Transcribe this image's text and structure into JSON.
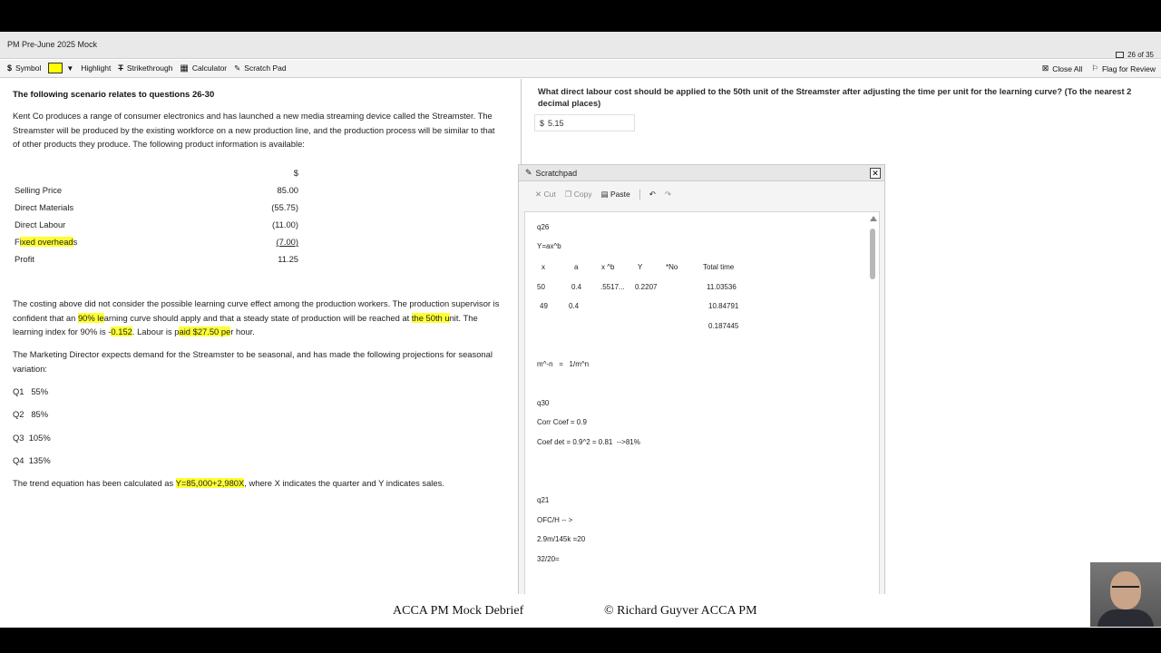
{
  "exam": {
    "title": "PM Pre-June 2025 Mock",
    "counter": "26 of 35"
  },
  "toolbar": {
    "symbol": "Symbol",
    "highlight": "Highlight",
    "strikethrough": "Strikethrough",
    "calculator": "Calculator",
    "scratch_pad": "Scratch Pad",
    "close_all": "Close All",
    "flag_for_review": "Flag for Review",
    "highlight_color": "#ffff00"
  },
  "scenario": {
    "heading": "The following scenario relates to questions 26-30",
    "intro": "Kent Co produces a range of consumer electronics and has launched a new media streaming device called the Streamster. The Streamster will be produced by the existing workforce on a new production line, and the production process will be similar to that of other products they produce. The following product information is available:",
    "table_header": "$",
    "rows": [
      {
        "label": "Selling Price",
        "value": "85.00"
      },
      {
        "label": "Direct Materials",
        "value": "(55.75)"
      },
      {
        "label": "Direct Labour",
        "value": "(11.00)"
      },
      {
        "label_a": "F",
        "label_hl": "ixed overhead",
        "label_b": "s",
        "value": "(7.00)"
      },
      {
        "label": "Profit",
        "value": "11.25"
      }
    ],
    "learning_p1": "The costing above did not consider the possible learning curve effect among the production workers. The production supervisor is confident that an ",
    "learning_hl1": "90% le",
    "learning_p2": "arning curve should apply and that a steady state of production will be reached at ",
    "learning_hl2": "the 50th u",
    "learning_p3": "nit. The learning index for 90% is ",
    "learning_p3b": "-",
    "learning_hl3": "0.152",
    "learning_p4": ". Labour is p",
    "learning_hl4": "aid $27.50 pe",
    "learning_p5": "r hour.",
    "marketing": "The Marketing Director expects demand for the Streamster to be seasonal, and has made the following projections for seasonal variation:",
    "seasonal": [
      "Q1   55%",
      "Q2   85%",
      "Q3  105%",
      "Q4  135%"
    ],
    "trend_a": "The trend equation has been calculated as ",
    "trend_hl": "Y=85,000+2,980X",
    "trend_b": ", where X indicates the quarter and Y indicates sales."
  },
  "question": {
    "text": "What direct labour cost should be applied to the 50th unit of the Streamster after adjusting the time per unit for the learning curve? (To the nearest 2 decimal places)",
    "currency": "$",
    "answer": "5.15"
  },
  "scratchpad": {
    "title": "Scratchpad",
    "cut": "Cut",
    "copy": "Copy",
    "paste": "Paste",
    "lines_top": [
      "q26",
      "Y=ax^b"
    ],
    "table_header": [
      "x",
      "a",
      "x ^b",
      "Y",
      "*No",
      "Total time"
    ],
    "table_rows": [
      [
        "50",
        "0.4",
        ".5517...",
        "0.2207",
        "",
        "11.03536"
      ],
      [
        "49",
        "0.4",
        "",
        "",
        "",
        "10.84791"
      ],
      [
        "",
        "",
        "",
        "",
        "",
        "0.187445"
      ]
    ],
    "line_mn": "m^-n   =   1/m^n",
    "q30": [
      "q30",
      "Corr Coef = 0.9",
      "Coef det = 0.9^2 = 0.81  -->81%"
    ],
    "q21": [
      "q21",
      "OFC/H -- >",
      "2.9m/145k =20",
      "32/20="
    ]
  },
  "footer": {
    "left": "ACCA PM Mock Debrief",
    "right": "© Richard Guyver ACCA PM"
  }
}
